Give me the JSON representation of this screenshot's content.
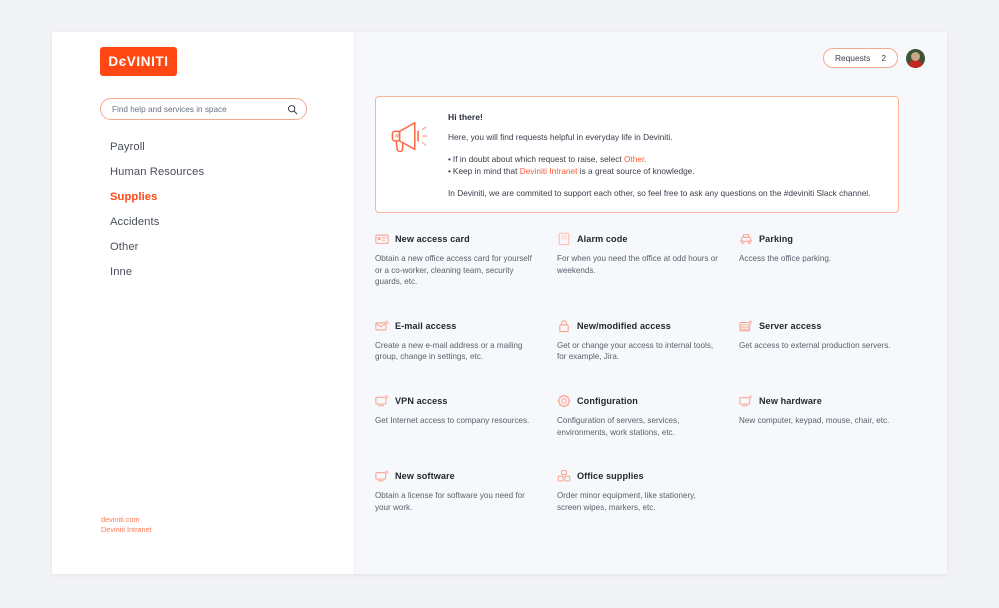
{
  "brand": {
    "wordmark": "DєVINITI"
  },
  "search": {
    "placeholder": "Find help and services in space",
    "value": "",
    "icon": "search-icon"
  },
  "sidebar": {
    "items": [
      {
        "label": "Payroll",
        "active": false
      },
      {
        "label": "Human Resources",
        "active": false
      },
      {
        "label": "Supplies",
        "active": true
      },
      {
        "label": "Accidents",
        "active": false
      },
      {
        "label": "Other",
        "active": false
      },
      {
        "label": "Inne",
        "active": false
      }
    ],
    "footer_links": [
      {
        "label": "deviniti.com"
      },
      {
        "label": "Deviniti Intranet"
      }
    ]
  },
  "topbar": {
    "requests_label": "Requests",
    "requests_count": "2",
    "avatar": "user-avatar"
  },
  "banner": {
    "icon": "megaphone-icon",
    "title": "Hi there!",
    "intro": "Here, you will find requests helpful in everyday life in Deviniti.",
    "bullets": [
      {
        "prefix": "If in doubt about which request to raise, select ",
        "link": "Other.",
        "suffix": ""
      },
      {
        "prefix": "Keep in mind that ",
        "link": "Deviniti Intranet",
        "suffix": " is a great source of knowledge."
      }
    ],
    "outro": "In Deviniti, we are commited to support each other, so feel free to ask any questions on the #deviniti Slack channel."
  },
  "cards": [
    {
      "icon": "access-card-icon",
      "title": "New access card",
      "desc": "Obtain a new office access card for yourself or a co-worker, cleaning team, security guards, etc."
    },
    {
      "icon": "alarm-code-icon",
      "title": "Alarm code",
      "desc": "For when you need the office at odd hours or weekends."
    },
    {
      "icon": "parking-car-icon",
      "title": "Parking",
      "desc": "Access the office parking."
    },
    {
      "icon": "email-icon",
      "title": "E-mail access",
      "desc": "Create a new e-mail address or a mailing group, change in settings, etc."
    },
    {
      "icon": "lock-icon",
      "title": "New/modified access",
      "desc": "Get or change your access to internal tools, for example, Jira."
    },
    {
      "icon": "server-icon",
      "title": "Server access",
      "desc": "Get access to external production servers."
    },
    {
      "icon": "vpn-icon",
      "title": "VPN access",
      "desc": "Get Internet access to company resources."
    },
    {
      "icon": "gear-icon",
      "title": "Configuration",
      "desc": "Configuration of servers, services, environments, work stations, etc."
    },
    {
      "icon": "new-hardware-icon",
      "title": "New hardware",
      "desc": "New computer, keypad, mouse, chair, etc."
    },
    {
      "icon": "new-software-icon",
      "title": "New software",
      "desc": "Obtain a license for software you need for your work."
    },
    {
      "icon": "office-supplies-icon",
      "title": "Office supplies",
      "desc": "Order minor equipment, like stationery, screen wipes, markers, etc."
    }
  ],
  "colors": {
    "brand_orange": "#ff4713",
    "accent_link": "#ff5a33",
    "icon_pink": "#f9a391",
    "page_bg": "#f2f3f5",
    "main_bg": "#f7f8fb"
  }
}
